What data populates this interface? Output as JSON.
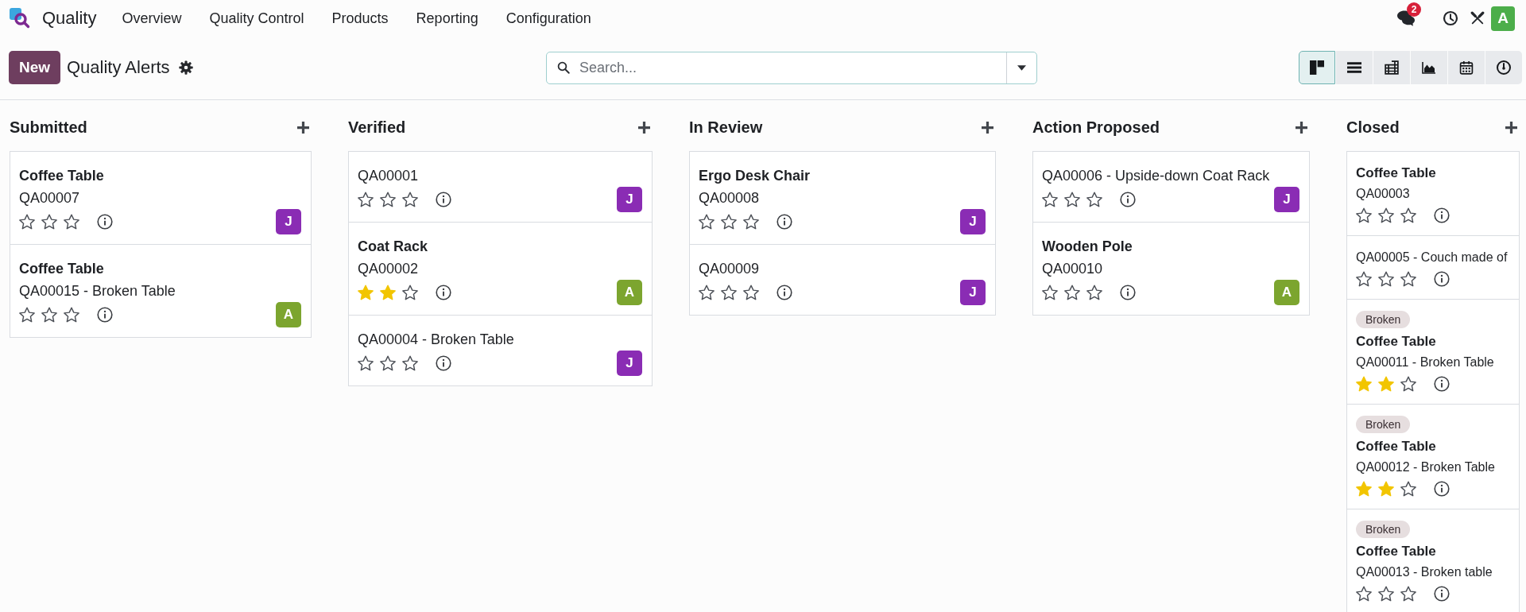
{
  "navbar": {
    "app_name": "Quality",
    "menu": [
      "Overview",
      "Quality Control",
      "Products",
      "Reporting",
      "Configuration"
    ],
    "messages_badge": "2",
    "user_initial": "A"
  },
  "control_panel": {
    "new_button": "New",
    "title": "Quality Alerts",
    "search": {
      "placeholder": "Search..."
    },
    "views": [
      {
        "kind": "kanban",
        "selected": true
      },
      {
        "kind": "list",
        "selected": false
      },
      {
        "kind": "pivot",
        "selected": false
      },
      {
        "kind": "graph",
        "selected": false
      },
      {
        "kind": "calendar",
        "selected": false
      },
      {
        "kind": "activity",
        "selected": false
      }
    ]
  },
  "columns": [
    {
      "title": "Submitted",
      "cards": [
        {
          "title": "Coffee Table",
          "reference": "QA00007",
          "stars": 0,
          "assignee": {
            "initial": "J",
            "color": "#8a2cb4"
          }
        },
        {
          "title": "Coffee Table",
          "reference": "QA00015 - Broken Table",
          "stars": 0,
          "assignee": {
            "initial": "A",
            "color": "#7ca52f"
          }
        }
      ]
    },
    {
      "title": "Verified",
      "cards": [
        {
          "reference": "QA00001",
          "stars": 0,
          "assignee": {
            "initial": "J",
            "color": "#8a2cb4"
          }
        },
        {
          "title": "Coat Rack",
          "reference": "QA00002",
          "stars": 2,
          "assignee": {
            "initial": "A",
            "color": "#7ca52f"
          }
        },
        {
          "reference": "QA00004 - Broken Table",
          "stars": 0,
          "assignee": {
            "initial": "J",
            "color": "#8a2cb4"
          }
        }
      ]
    },
    {
      "title": "In Review",
      "cards": [
        {
          "title": "Ergo Desk Chair",
          "reference": "QA00008",
          "stars": 0,
          "assignee": {
            "initial": "J",
            "color": "#8a2cb4"
          }
        },
        {
          "reference": "QA00009",
          "stars": 0,
          "assignee": {
            "initial": "J",
            "color": "#8a2cb4"
          }
        }
      ]
    },
    {
      "title": "Action Proposed",
      "cards": [
        {
          "reference": "QA00006 - Upside-down Coat Rack",
          "stars": 0,
          "assignee": {
            "initial": "J",
            "color": "#8a2cb4"
          }
        },
        {
          "title": "Wooden Pole",
          "reference": "QA00010",
          "stars": 0,
          "assignee": {
            "initial": "A",
            "color": "#7ca52f"
          }
        }
      ]
    },
    {
      "title": "Closed",
      "cards": [
        {
          "title": "Coffee Table",
          "reference": "QA00003",
          "stars": 0
        },
        {
          "reference": "QA00005 - Couch made of",
          "stars": 0
        },
        {
          "tags": [
            "Broken"
          ],
          "title": "Coffee Table",
          "reference": "QA00011 - Broken Table",
          "stars": 2
        },
        {
          "tags": [
            "Broken"
          ],
          "title": "Coffee Table",
          "reference": "QA00012 - Broken Table",
          "stars": 2
        },
        {
          "tags": [
            "Broken"
          ],
          "title": "Coffee Table",
          "reference": "QA00013 - Broken table",
          "stars": 0
        }
      ]
    }
  ]
}
